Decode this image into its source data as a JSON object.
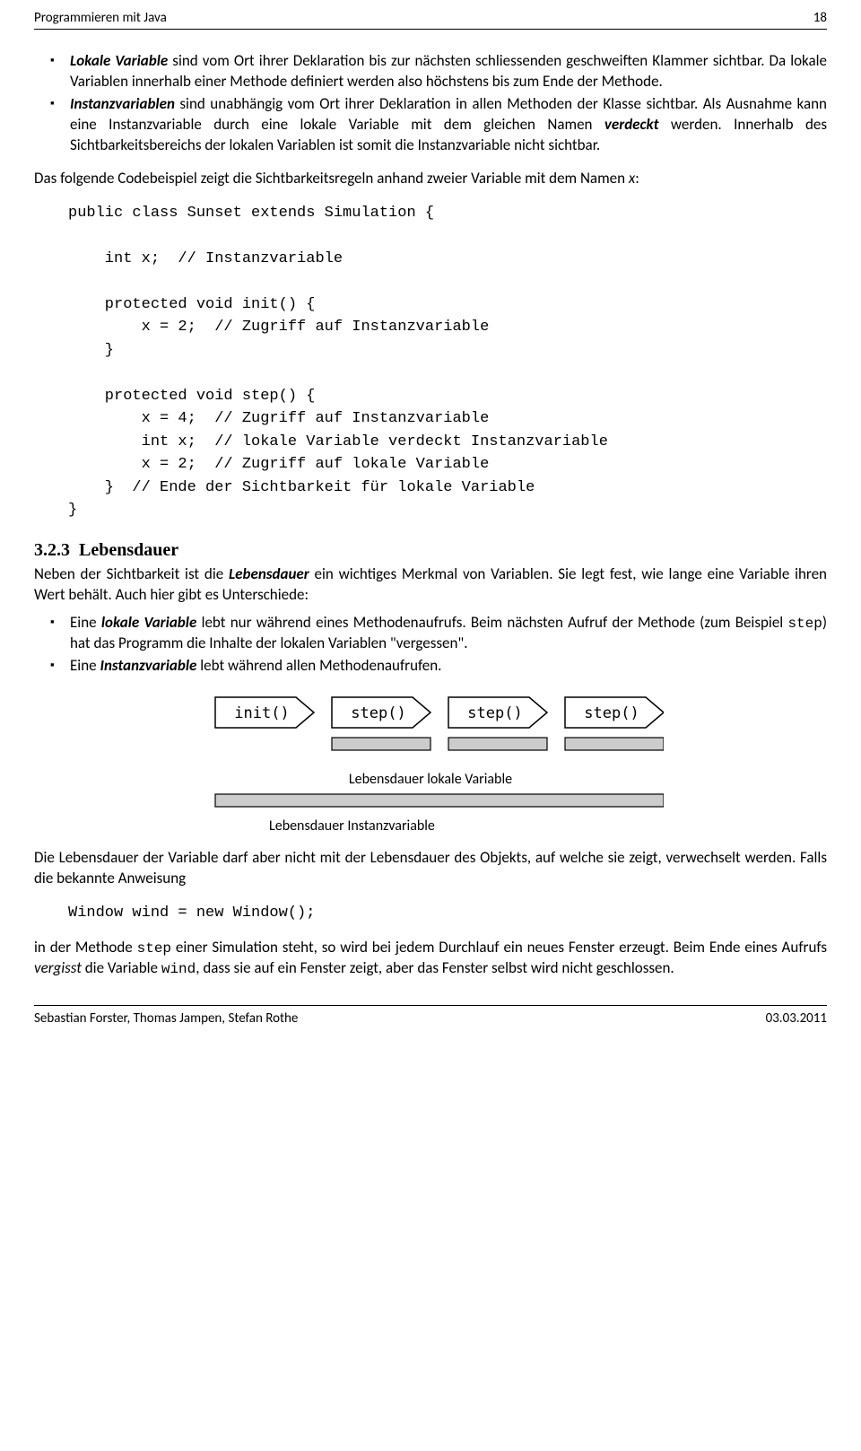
{
  "header": {
    "title": "Programmieren mit Java",
    "page": "18"
  },
  "bullets1": {
    "item1_pre": "Lokale Variable",
    "item1_rest": " sind vom Ort ihrer Deklaration bis zur nächsten schliessenden geschweiften Klammer sichtbar. Da lokale Variablen innerhalb einer Methode definiert werden also höchstens bis zum Ende der Methode.",
    "item2_pre": "Instanzvariablen",
    "item2_mid": " sind unabhängig vom Ort ihrer Deklaration in allen Methoden der Klasse sichtbar. Als Ausnahme kann eine Instanzvariable durch eine lokale Variable mit dem gleichen Namen ",
    "item2_verdeckt": "verdeckt",
    "item2_rest": " werden. Innerhalb des Sichtbarkeitsbereichs der lokalen Variablen ist somit die Instanzvariable nicht sichtbar."
  },
  "para1_pre": "Das folgende Codebeispiel zeigt die Sichtbarkeitsregeln anhand zweier Variable mit dem Namen ",
  "para1_var": "x",
  "para1_post": ":",
  "code1": "public class Sunset extends Simulation {\n\n    int x;  // Instanzvariable\n\n    protected void init() {\n        x = 2;  // Zugriff auf Instanzvariable\n    }\n\n    protected void step() {\n        x = 4;  // Zugriff auf Instanzvariable\n        int x;  // lokale Variable verdeckt Instanzvariable\n        x = 2;  // Zugriff auf lokale Variable\n    }  // Ende der Sichtbarkeit für lokale Variable\n}",
  "section": {
    "number": "3.2.3",
    "title": "Lebensdauer"
  },
  "para2_pre": "Neben der Sichtbarkeit ist die ",
  "para2_leb": "Lebensdauer",
  "para2_rest": " ein wichtiges Merkmal von Variablen. Sie legt fest, wie lange eine Variable ihren Wert behält. Auch hier gibt es Unterschiede:",
  "bullets2": {
    "item1_a": "Eine ",
    "item1_b": "lokale Variable",
    "item1_c": " lebt nur während eines Methodenaufrufs. Beim nächsten Aufruf der Methode (zum Beispiel ",
    "item1_step": "step",
    "item1_d": ") hat das Programm die Inhalte der lokalen Variablen \"vergessen\".",
    "item2_a": "Eine ",
    "item2_b": "Instanzvariable",
    "item2_c": " lebt während allen Methodenaufrufen."
  },
  "diagram": {
    "init": "init()",
    "step": "step()",
    "label_local": "Lebensdauer lokale Variable",
    "label_inst": "Lebensdauer Instanzvariable"
  },
  "para3": "Die Lebensdauer der Variable darf aber nicht mit der Lebensdauer des Objekts, auf welche sie zeigt, verwechselt werden. Falls die bekannte Anweisung",
  "code2": "Window wind = new Window();",
  "para4_a": "in der Methode ",
  "para4_step": "step",
  "para4_b": " einer Simulation steht, so wird bei jedem Durchlauf ein neues Fenster erzeugt. Beim Ende eines Aufrufs ",
  "para4_verg": "vergisst",
  "para4_c": " die Variable ",
  "para4_wind": "wind",
  "para4_d": ", dass sie auf ein Fenster zeigt, aber das Fenster selbst wird nicht geschlossen.",
  "footer": {
    "authors": "Sebastian Forster, Thomas Jampen, Stefan Rothe",
    "date": "03.03.2011"
  }
}
